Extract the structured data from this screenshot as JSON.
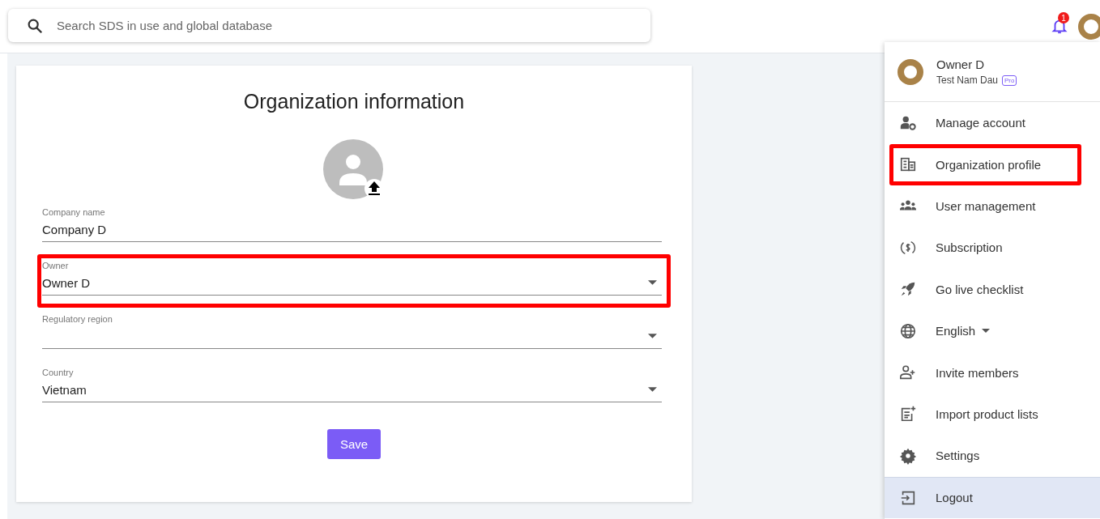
{
  "search": {
    "placeholder": "Search SDS in use and global database"
  },
  "notifications": {
    "count": "1"
  },
  "form": {
    "title": "Organization information",
    "fields": [
      {
        "kind": "text",
        "label": "Company name",
        "value": "Company D",
        "highlighted": false
      },
      {
        "kind": "select",
        "label": "Owner",
        "value": "Owner D",
        "highlighted": true
      },
      {
        "kind": "select",
        "label": "Regulatory region",
        "highlighted": false
      },
      {
        "kind": "select",
        "label": "Country",
        "value": "Vietnam",
        "highlighted": false
      }
    ],
    "save_button": "Save"
  },
  "account_menu": {
    "name": "Owner D",
    "organization": "Test Nam Dau",
    "plan": "Pro",
    "items": [
      {
        "kind": "account",
        "label": "Manage account",
        "selected": false,
        "highlighted": false
      },
      {
        "kind": "organization",
        "label": "Organization profile",
        "selected": false,
        "highlighted": true
      },
      {
        "kind": "users",
        "label": "User management",
        "selected": false,
        "highlighted": false
      },
      {
        "kind": "subscription",
        "label": "Subscription",
        "selected": false,
        "highlighted": false
      },
      {
        "kind": "rocket",
        "label": "Go live checklist",
        "selected": false,
        "highlighted": false
      },
      {
        "kind": "language",
        "label": "English",
        "selected": false,
        "highlighted": false
      },
      {
        "kind": "invite",
        "label": "Invite members",
        "selected": false,
        "highlighted": false
      },
      {
        "kind": "import",
        "label": "Import product lists",
        "selected": false,
        "highlighted": false
      },
      {
        "kind": "settings",
        "label": "Settings",
        "selected": false,
        "highlighted": false
      },
      {
        "kind": "logout",
        "label": "Logout",
        "selected": true,
        "highlighted": false
      }
    ]
  }
}
